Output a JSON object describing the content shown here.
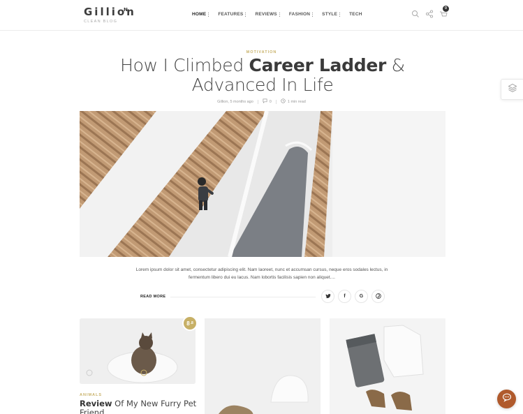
{
  "brand": {
    "name": "Gillion",
    "superscript": "N",
    "tagline": "CLEAN BLOG"
  },
  "nav": {
    "items": [
      {
        "label": "HOME",
        "has_dropdown": true,
        "active": true
      },
      {
        "label": "FEATURES",
        "has_dropdown": true,
        "active": false
      },
      {
        "label": "REVIEWS",
        "has_dropdown": true,
        "active": false
      },
      {
        "label": "FASHION",
        "has_dropdown": true,
        "active": false
      },
      {
        "label": "STYLE",
        "has_dropdown": true,
        "active": false
      },
      {
        "label": "TECH",
        "has_dropdown": false,
        "active": false
      }
    ]
  },
  "header_icons": {
    "search": "search-icon",
    "share": "share-icon",
    "cart": "cart-icon",
    "cart_count": "0"
  },
  "post": {
    "category": "MOTIVATION",
    "title_part1": "How I Climbed ",
    "title_highlight": "Career Ladder",
    "title_part2": " & Advanced In Life",
    "author_date": "Gillion, 5 months ago",
    "comments": "0",
    "read_time": "1 min read",
    "excerpt": "Lorem ipsum dolor sit amet, consectetur adipiscing elit. Nam laoreet, nunc et accumsan cursus, neque eros sodales lectus, in fermentum libero dui eu lacus. Nam lobortis facilisis sapien non aliquet....",
    "read_more": "READ MORE"
  },
  "share_buttons": [
    {
      "name": "twitter-icon",
      "glyph": "t"
    },
    {
      "name": "facebook-icon",
      "glyph": "f"
    },
    {
      "name": "google-icon",
      "glyph": "G"
    },
    {
      "name": "pinterest-icon",
      "glyph": "p"
    }
  ],
  "cards": [
    {
      "score_main": "8",
      "score_decimal": ".8",
      "category": "ANIMALS",
      "title_highlight": "Review",
      "title_rest": " Of My New Furry Pet Friend"
    }
  ],
  "colors": {
    "accent": "#c9b26a",
    "chat": "#b05a2c"
  }
}
